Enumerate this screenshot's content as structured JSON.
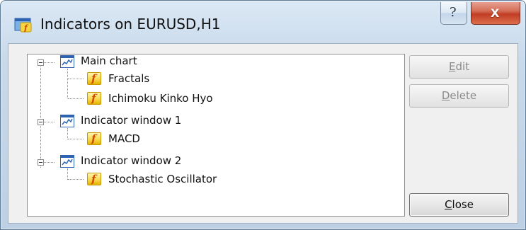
{
  "window": {
    "title": "Indicators on EURUSD,H1",
    "controls": {
      "help": "?",
      "close": "X"
    }
  },
  "tree": {
    "groups": [
      {
        "label": "Main chart",
        "icon": "chart-window-icon",
        "items": [
          {
            "label": "Fractals",
            "icon": "indicator-icon"
          },
          {
            "label": "Ichimoku Kinko Hyo",
            "icon": "indicator-icon"
          }
        ]
      },
      {
        "label": "Indicator window 1",
        "icon": "chart-window-icon",
        "items": [
          {
            "label": "MACD",
            "icon": "indicator-icon"
          }
        ]
      },
      {
        "label": "Indicator window 2",
        "icon": "chart-window-icon",
        "items": [
          {
            "label": "Stochastic Oscillator",
            "icon": "indicator-icon"
          }
        ]
      }
    ]
  },
  "buttons": {
    "edit": {
      "mnemonic": "E",
      "rest": "dit",
      "enabled": false
    },
    "delete": {
      "mnemonic": "D",
      "rest": "elete",
      "enabled": false
    },
    "close": {
      "mnemonic": "C",
      "rest": "lose",
      "enabled": true
    }
  },
  "icons": {
    "app": "indicators-app-icon",
    "help": "help-icon",
    "close": "close-icon",
    "expanded_node": "minus-icon"
  },
  "colors": {
    "title_bar": "#c8d9ea",
    "close_button": "#c13d25",
    "tree_lines": "#8d8d8d",
    "chart_icon": "#2d63b1",
    "indicator_icon": "#f6d444"
  }
}
